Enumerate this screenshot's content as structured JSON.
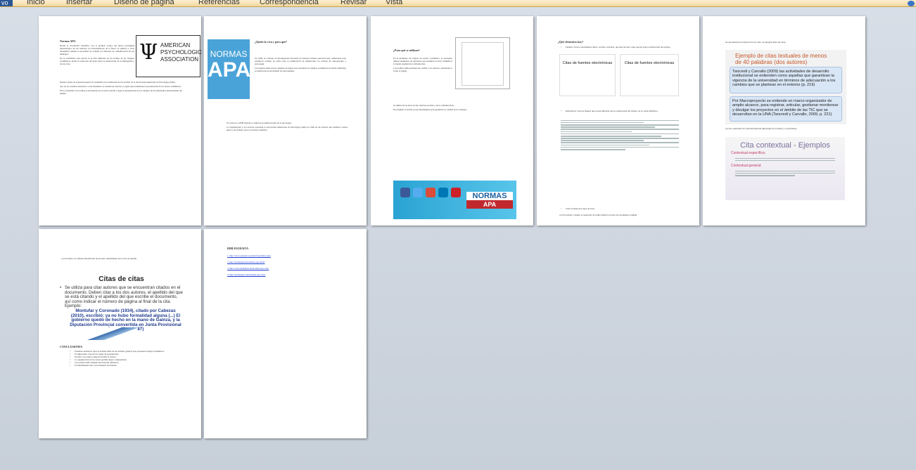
{
  "ribbon": {
    "file_tab": "vo",
    "tabs": [
      "Inicio",
      "Insertar",
      "Diseño de página",
      "Referencias",
      "Correspondencia",
      "Revisar",
      "Vista"
    ]
  },
  "page1": {
    "heading": "Normas APA",
    "logo_text": [
      "AMERICAN",
      "PSYCHOLOGICAL",
      "ASSOCIATION"
    ],
    "paragraphs": [
      "Desde la revolución científica, con el gradual avance del nuevo paradigma metodológico de las ciencias, los investigadores de la física, la química y otras disciplinas sienten la necesidad de ordenar los métodos de comunicación de sus hallazgos.",
      "En la actualidad, este patrón es el más utilizado en las formas de los trabajos académicos, desde la redacción del texto hasta la elaboración de la bibliografía y de sus citas.",
      "Nuestra forma de expresión puede ser resumida en la utilización de las normas de la Asociación Americana de Psicología (APA).",
      "Así, en los estudios anteriores a este fenómeno se establecen criterios y reglas que normalizan la presentación de los textos académicos.",
      "En la actualidad, las normas se encuentran en su sexta edición y rigen la presentación de los trabajos de las principales universidades del mundo."
    ]
  },
  "page2": {
    "logo_top": "NORMAS",
    "logo_bottom": "APA",
    "question": "¿Quién la crea y para qué?",
    "paragraphs": [
      "En 1929, el Consejo de Investigación Nacional de Estados Unidos patrocinó una conferencia para establecer normas de estilo para la publicación de manuscritos en revistas de antropología y psicología.",
      "Las normas APA son un conjunto de reglas para presentar los trabajos académicos de modo uniforme; se publicaron en un manual de siete páginas.",
      "Se convocó a 2008 usuarios y editores de publicaciones de la psicología.",
      "La organización y los sectores acuerdan la Asociación Americana de Psicología (APA) en 1929 en un artículo que establece ciertas guías y un formato para la escritura científica."
    ]
  },
  "page3": {
    "question": "¿Para qué se utilizan?",
    "paragraphs": [
      "En el momento de realizar un escrito académico, es necesario utilizar elementos de referencia que permitan al lector identificar la fuente original de la información.",
      "Las normas APA permiten dar crédito a los autores consultados y evitar el plagio.",
      "Se utiliza en las áreas de las ciencias sociales y de la comunicación.",
      "En resumen la norma es una herramienta para garantizar la calidad de los trabajos."
    ]
  },
  "page4": {
    "question": "¿Qué elementos hay?",
    "bullet1": "Fuentes: Son los documentos libros, revistas, artículos, que han servido como soporte para la elaboración del trabajo.",
    "slide_left_title": "Citas de fuentes electrónicas",
    "slide_right_title": "Citas de fuentes electrónicas",
    "bullet2": "Referencias: Son las fuentes que se han utilizado para la elaboración del trabajo, en el orden alfabético.",
    "bullet3": "Citas: Existen tres tipos de citas:",
    "paragraph": "a) Cita textual: Cuando se transcribe de forma idéntica el texto del documento original."
  },
  "page5": {
    "intro": "las que muestran la mayoría de las citas. Se agregan antes del autor.",
    "slide_title": "Ejemplo de citas textuales de menos de 40 palabras (dos autores)",
    "quote1": "Tancredi y Carvallo (2009) las actividades de desarrollo institucional se entienden como aquellas que garantizan la vigencia de la universidad en términos de adecuación a los cambios que se plantean en el entorno (p. 219)",
    "quote2": "Por Macroproyecto se entiende un marco organizador de amplio alcance, para registrar, articular, gestionar monitorear y divulgar los proyectos en el ámbito de las TIC que se desarrollan en la UNA (Tancredi y Carvallo, 2009, p. 221)",
    "paragraph": "b) Cita contextual: Se toma información importante de la fuente y se parafrasea.",
    "cita_title": "Cita contextual - Ejemplos",
    "cita_items": [
      "Contextual específica:",
      "Contextual general:"
    ]
  },
  "page6": {
    "paragraph": "c) Cita mixta: Se obtiene información de un autor determinado de la obra en estudio.",
    "slide_title": "Citas de citas",
    "slide_text": "Se utiliza para citar autores que se encuentran citados en el documento. Deben citar a los dos autores, el apellido del que se está citando y el apellido del que escribe el documento, así como indicar el número de página al final de la cita. Ejemplo:",
    "slide_quote": "Montufar y Coronado (1934), citado por Cabezas (2010), escribió: ya no hubo formalidad alguna (...) El gobierno quedó de hecho en la mano de Gainza, y la Diputación Provincial convertida en Junta Provisional Consultiva. (p.87)",
    "conclusion_title": "CONCLUSIONES",
    "conclusions": [
      "Podemos establecer que las normas APA son un formato general para presentar trabajos académicos.",
      "Es importante conocer las reglas de presentación.",
      "Escribir con orden y método facilita la lectura.",
      "La organización en los textos permite mejor comprensión.",
      "Las normas APA cumplen una función formativa.",
      "Es fundamental citar correctamente las fuentes."
    ]
  },
  "page7": {
    "title": "BIBLIOGRAFIA",
    "links": [
      "1. http://www.apastyle.org/learn/faqs/index.aspx",
      "2. http://normasapa.net/normas-apa-2016/",
      "3. http://www.slideshare.net/normas-apa-citas/",
      "4. http://normasapa.com/normas-apa-citas/"
    ]
  }
}
